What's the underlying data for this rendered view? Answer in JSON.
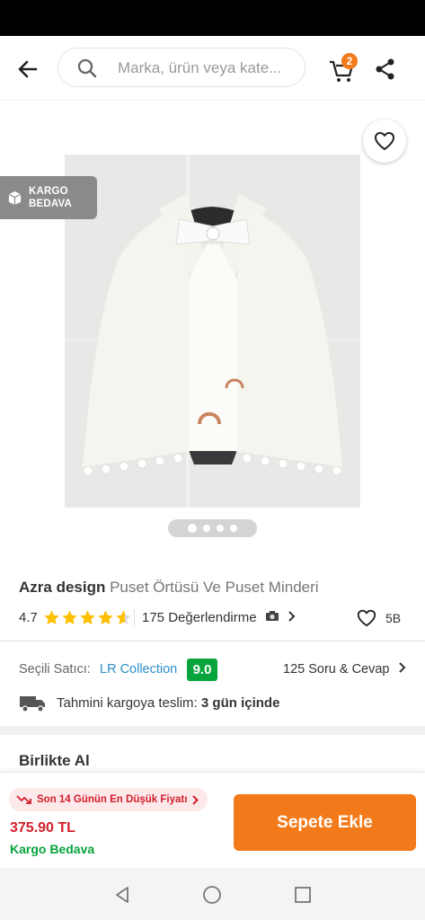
{
  "search": {
    "placeholder": "Marka, ürün veya kate..."
  },
  "cart": {
    "count": "2"
  },
  "icons": {
    "back": "arrow-left-icon",
    "search": "search-icon",
    "cart": "cart-icon",
    "share": "share-icon",
    "favorite": "heart-icon",
    "box": "box-icon",
    "truck": "truck-icon",
    "camera": "camera-icon",
    "trend": "trend-down-icon"
  },
  "badge": {
    "line1": "KARGO",
    "line2": "BEDAVA"
  },
  "carousel": {
    "total": 4,
    "active": 1
  },
  "product": {
    "brand": "Azra design",
    "name": "Puset Örtüsü Ve Puset Minderi",
    "rating": "4.7",
    "rating_value": 4.7,
    "review_count": "175 Değerlendirme",
    "likes": "5B"
  },
  "seller": {
    "label": "Seçili Satıcı:",
    "name": "LR Collection",
    "score": "9.0",
    "qa_link": "125 Soru & Cevap"
  },
  "delivery": {
    "label": "Tahmini kargoya teslim:",
    "days": "3 gün içinde"
  },
  "section": {
    "together_title": "Birlikte Al"
  },
  "bottom": {
    "lowest_price_badge": "Son 14 Günün En Düşük Fiyatı",
    "price": "375.90 TL",
    "shipping": "Kargo Bedava",
    "add_to_cart": "Sepete Ekle"
  },
  "colors": {
    "accent_orange": "#f27a1a",
    "price_red": "#d21e2b",
    "success_green": "#07a33c",
    "seller_blue": "#2d8ec7"
  }
}
